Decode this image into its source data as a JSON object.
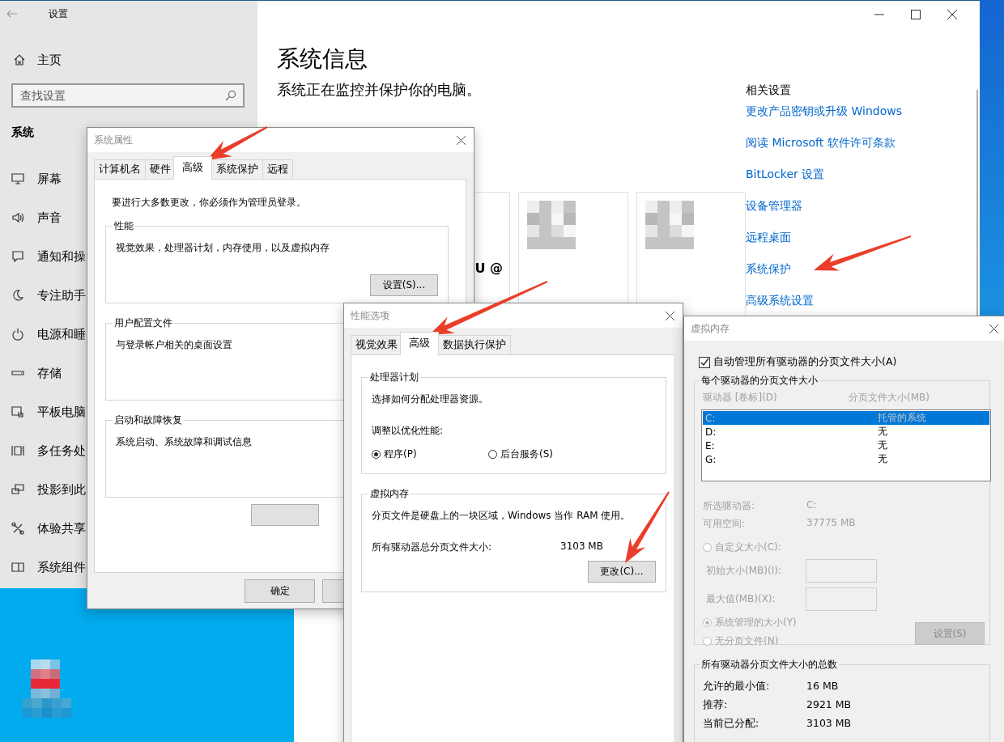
{
  "settings": {
    "title": "设置",
    "home": "主页",
    "search": {
      "placeholder": "查找设置"
    },
    "section": "系统",
    "nav": [
      {
        "label": "屏幕"
      },
      {
        "label": "声音"
      },
      {
        "label": "通知和操"
      },
      {
        "label": "专注助手"
      },
      {
        "label": "电源和睡"
      },
      {
        "label": "存储"
      },
      {
        "label": "平板电脑"
      },
      {
        "label": "多任务处"
      },
      {
        "label": "投影到此"
      },
      {
        "label": "体验共享"
      },
      {
        "label": "系统组件"
      }
    ],
    "heading": "系统信息",
    "subtitle": "系统正在监控并保护你的电脑。",
    "card_text": "U @",
    "related": {
      "title": "相关设置",
      "links": [
        "更改产品密钥或升级 Windows",
        "阅读 Microsoft 软件许可条款",
        "BitLocker 设置",
        "设备管理器",
        "远程桌面",
        "系统保护",
        "高级系统设置"
      ]
    }
  },
  "system_properties": {
    "title": "系统属性",
    "tabs": [
      {
        "label": "计算机名",
        "selected": false
      },
      {
        "label": "硬件",
        "selected": false
      },
      {
        "label": "高级",
        "selected": true
      },
      {
        "label": "系统保护",
        "selected": false
      },
      {
        "label": "远程",
        "selected": false
      }
    ],
    "notice": "要进行大多数更改，你必须作为管理员登录。",
    "groups": [
      {
        "title": "性能",
        "text": "视觉效果，处理器计划，内存使用，以及虚拟内存",
        "button": "设置(S)..."
      },
      {
        "title": "用户配置文件",
        "text": "与登录帐户相关的桌面设置"
      },
      {
        "title": "启动和故障恢复",
        "text": "系统启动、系统故障和调试信息"
      }
    ],
    "ok_button": "确定"
  },
  "performance_options": {
    "title": "性能选项",
    "tabs": [
      {
        "label": "视觉效果",
        "selected": false
      },
      {
        "label": "高级",
        "selected": true
      },
      {
        "label": "数据执行保护",
        "selected": false
      }
    ],
    "processor": {
      "title": "处理器计划",
      "text": "选择如何分配处理器资源。",
      "prompt": "调整以优化性能:",
      "options": [
        {
          "label": "程序(P)",
          "selected": true
        },
        {
          "label": "后台服务(S)",
          "selected": false
        }
      ]
    },
    "virtual_memory": {
      "title": "虚拟内存",
      "text": "分页文件是硬盘上的一块区域，Windows 当作 RAM 使用。",
      "total_label": "所有驱动器总分页文件大小:",
      "total_value": "3103 MB",
      "button": "更改(C)..."
    }
  },
  "virtual_memory": {
    "title": "虚拟内存",
    "auto_manage": {
      "label": "自动管理所有驱动器的分页文件大小(A)",
      "checked": true
    },
    "per_drive": {
      "title": "每个驱动器的分页文件大小",
      "columns": [
        {
          "label": "驱动器 [卷标](D)",
          "disabled": true
        },
        {
          "label": "分页文件大小(MB)",
          "disabled": true
        }
      ],
      "drives": [
        {
          "drive": "C:",
          "size": "托管的系统",
          "selected": true
        },
        {
          "drive": "D:",
          "size": "无",
          "selected": false
        },
        {
          "drive": "E:",
          "size": "无",
          "selected": false
        },
        {
          "drive": "G:",
          "size": "无",
          "selected": false
        }
      ],
      "info": [
        {
          "label": "所选驱动器:",
          "value": "C:",
          "disabled": true
        },
        {
          "label": "可用空间:",
          "value": "37775 MB",
          "disabled": true
        }
      ],
      "options": [
        {
          "kind": "radio",
          "label": "自定义大小(C):",
          "selected": false,
          "disabled": true
        },
        {
          "kind": "field",
          "label": "初始大小(MB)(I):",
          "disabled": true
        },
        {
          "kind": "field",
          "label": "最大值(MB)(X):",
          "disabled": true
        },
        {
          "kind": "radio",
          "label": "系统管理的大小(Y)",
          "selected": true,
          "disabled": true
        },
        {
          "kind": "radio",
          "label": "无分页文件(N)",
          "selected": false,
          "disabled": true
        }
      ],
      "set_button": {
        "label": "设置(S)",
        "disabled": true
      }
    },
    "totals": {
      "title": "所有驱动器分页文件大小的总数",
      "rows": [
        {
          "label": "允许的最小值:",
          "value": "16 MB"
        },
        {
          "label": "推荐:",
          "value": "2921 MB"
        },
        {
          "label": "当前已分配:",
          "value": "3103 MB"
        }
      ]
    }
  }
}
